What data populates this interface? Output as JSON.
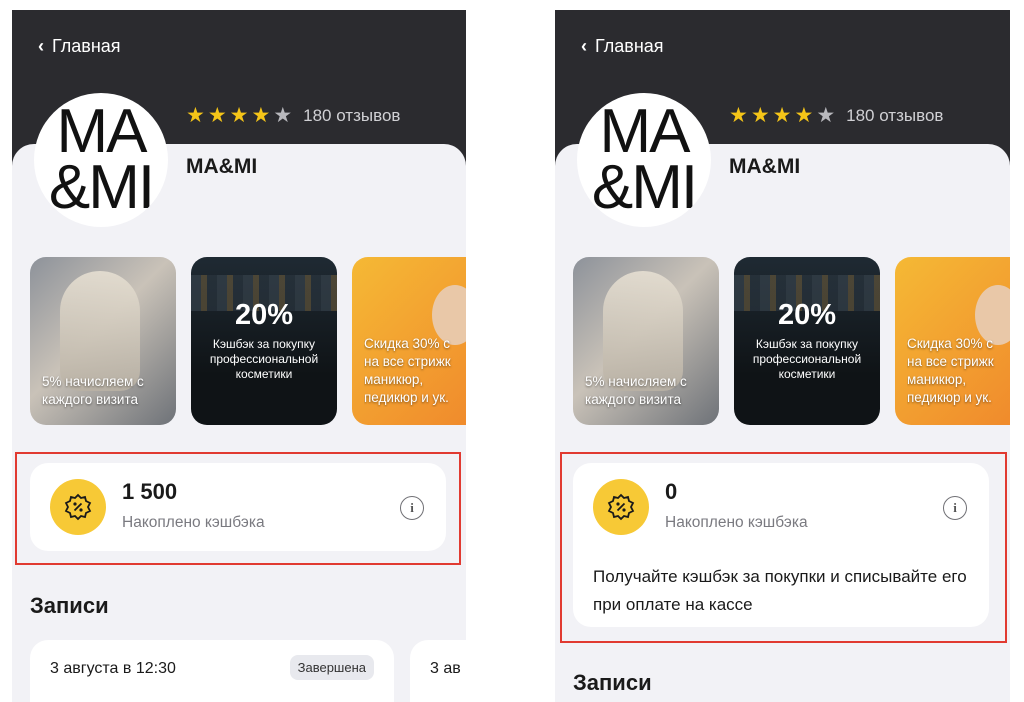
{
  "screens": [
    {
      "back_label": "Главная",
      "logo_text": "MA\n&MI",
      "rating": {
        "stars_filled": 4,
        "stars_total": 5,
        "reviews": "180 отзывов"
      },
      "name": "MA&MI",
      "promos": [
        {
          "caption": "5% начисляем с каждого визита"
        },
        {
          "big": "20%",
          "caption": "Кэшбэк за покупку профессиональной косметики"
        },
        {
          "caption": "Скидка 30% с\nна все стрижк\nманикюр,\nпедикюр и ук."
        }
      ],
      "cashback": {
        "amount": "1 500",
        "label": "Накоплено кэшбэка",
        "note": ""
      },
      "section_title": "Записи",
      "records": [
        {
          "date": "3 августа в 12:30",
          "status": "Завершена"
        },
        {
          "date": "3 ав",
          "status": ""
        }
      ]
    },
    {
      "back_label": "Главная",
      "logo_text": "MA\n&MI",
      "rating": {
        "stars_filled": 4,
        "stars_total": 5,
        "reviews": "180 отзывов"
      },
      "name": "MA&MI",
      "promos": [
        {
          "caption": "5% начисляем с каждого визита"
        },
        {
          "big": "20%",
          "caption": "Кэшбэк за покупку профессиональной косметики"
        },
        {
          "caption": "Скидка 30% с\nна все стрижк\nманикюр,\nпедикюр и ук."
        }
      ],
      "cashback": {
        "amount": "0",
        "label": "Накоплено кэшбэка",
        "note": "Получайте кэшбэк за покупки и списывайте его при оплате на кассе"
      },
      "section_title": "Записи",
      "records": []
    }
  ],
  "colors": {
    "header": "#2b2b2f",
    "accent": "#f7c936",
    "star": "#f5c518",
    "highlight": "#e13a31"
  },
  "icons": {
    "back": "chevron-left-icon",
    "star": "star-icon",
    "badge": "cashback-percent-icon",
    "info": "info-icon"
  }
}
